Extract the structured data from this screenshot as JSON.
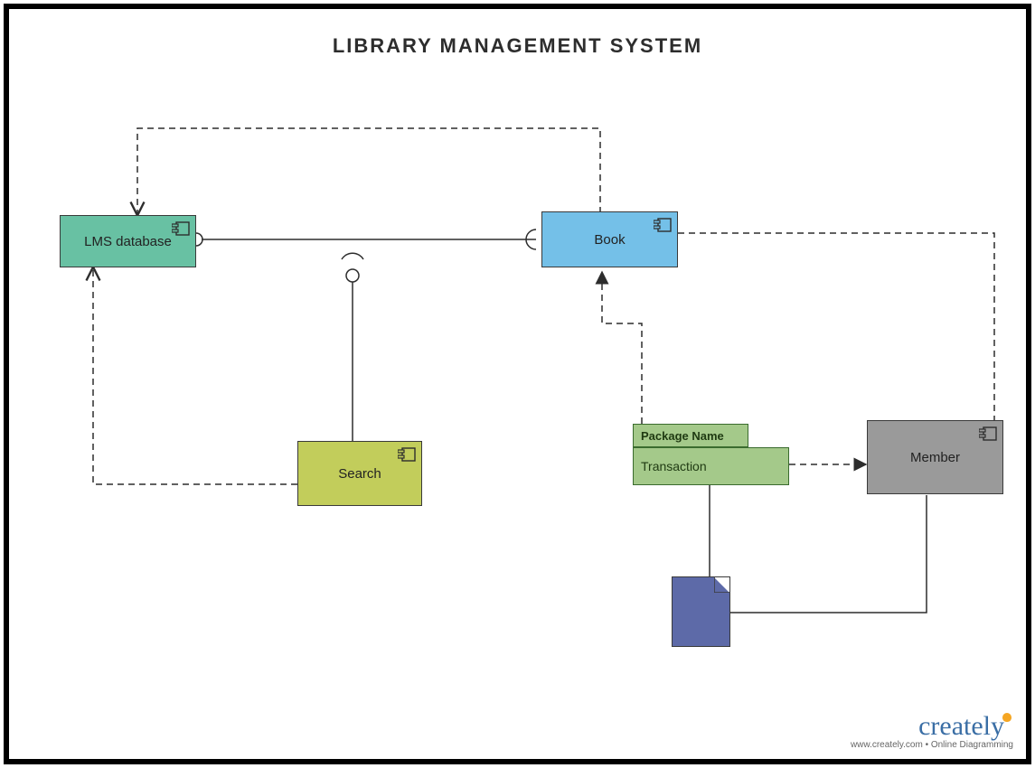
{
  "title": "LIBRARY MANAGEMENT SYSTEM",
  "components": {
    "lms_db": {
      "label": "LMS database",
      "fill": "#68c1a3"
    },
    "book": {
      "label": "Book",
      "fill": "#74c0e8"
    },
    "search": {
      "label": "Search",
      "fill": "#c2cd5b"
    },
    "member": {
      "label": "Member",
      "fill": "#9a9a9a"
    }
  },
  "package": {
    "tab_label": "Package Name",
    "body_label": "Transaction"
  },
  "footer": {
    "brand": "creately",
    "tagline": "www.creately.com • Online Diagramming"
  }
}
